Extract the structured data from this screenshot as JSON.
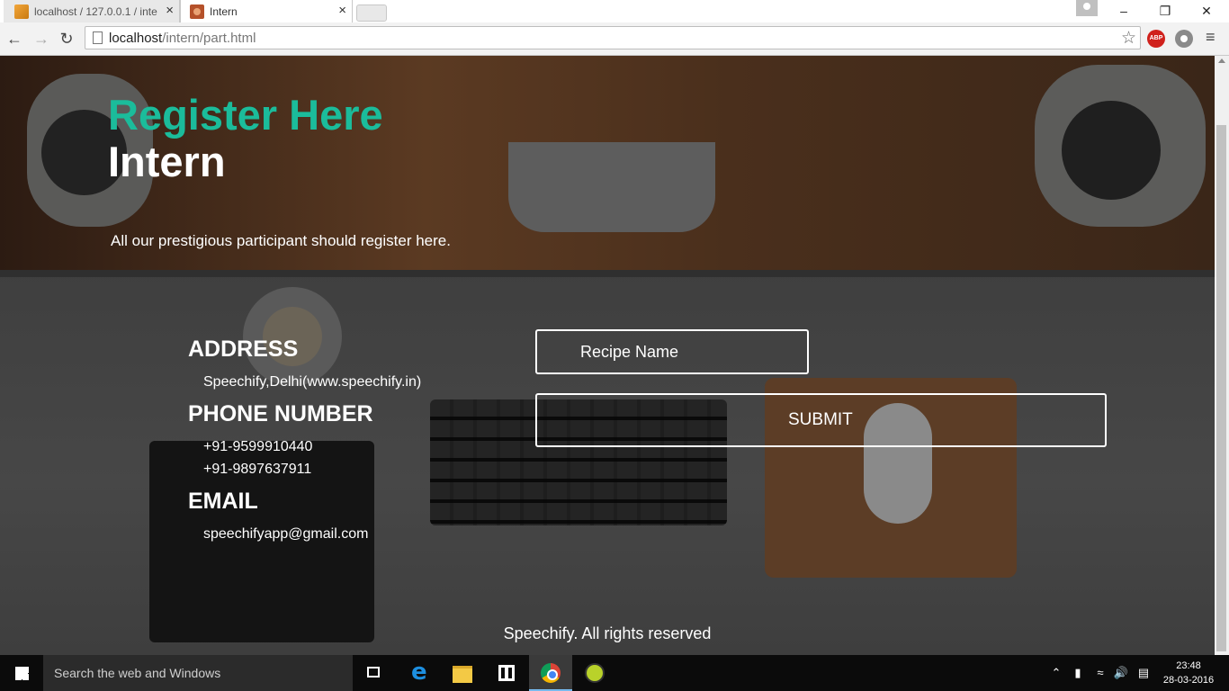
{
  "browser": {
    "tabs": [
      {
        "title": "localhost / 127.0.0.1 / inte",
        "active": false,
        "favicon": "phpmyadmin-icon"
      },
      {
        "title": "Intern",
        "active": true,
        "favicon": "intern-favicon"
      }
    ],
    "close_glyph": "×",
    "url_host": "localhost",
    "url_path": "/intern/part.html",
    "abp_label": "ABP",
    "window_controls": {
      "minimize": "–",
      "maximize": "❐",
      "close": "✕"
    }
  },
  "page": {
    "title_line1": "Register Here",
    "title_line2": "Intern",
    "tagline": "All our prestigious participant should register here.",
    "contact": {
      "address_heading": "ADDRESS",
      "address": "Speechify,Delhi(www.speechify.in)",
      "phone_heading": "PHONE NUMBER",
      "phone1": "+91-9599910440",
      "phone2": "+91-9897637911",
      "email_heading": "EMAIL",
      "email": "speechifyapp@gmail.com"
    },
    "form": {
      "recipe_placeholder": "Recipe Name",
      "submit_label": "SUBMIT"
    },
    "footer": "Speechify. All rights reserved",
    "colors": {
      "accent": "#1bbc9b",
      "text": "#ffffff"
    }
  },
  "taskbar": {
    "search_placeholder": "Search the web and Windows",
    "time": "23:48",
    "date": "28-03-2016",
    "pinned": [
      "task-view-icon",
      "edge-icon",
      "file-explorer-icon",
      "store-icon",
      "chrome-icon",
      "app-icon"
    ]
  }
}
